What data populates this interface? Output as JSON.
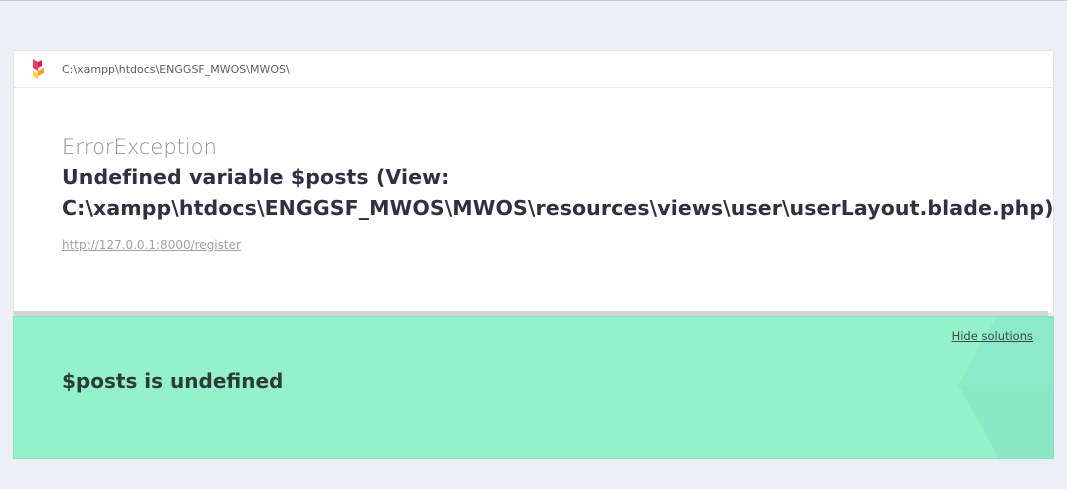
{
  "header": {
    "path": "C:\\xampp\\htdocs\\ENGGSF_MWOS\\MWOS\\",
    "logo_icon": "ignition-logo-icon"
  },
  "exception": {
    "class": "ErrorException",
    "message_line1": "Undefined variable $posts (View:",
    "message_line2": "C:\\xampp\\htdocs\\ENGGSF_MWOS\\MWOS\\resources\\views\\user\\userLayout.blade.php)",
    "url": "http://127.0.0.1:8000/register"
  },
  "solution": {
    "hide_label": "Hide solutions",
    "title": "$posts is undefined"
  },
  "colors": {
    "background": "#eeeff4",
    "solution_bg": "#94f2cb",
    "text_dark": "#2f3042",
    "text_muted": "#8f8c9c"
  }
}
